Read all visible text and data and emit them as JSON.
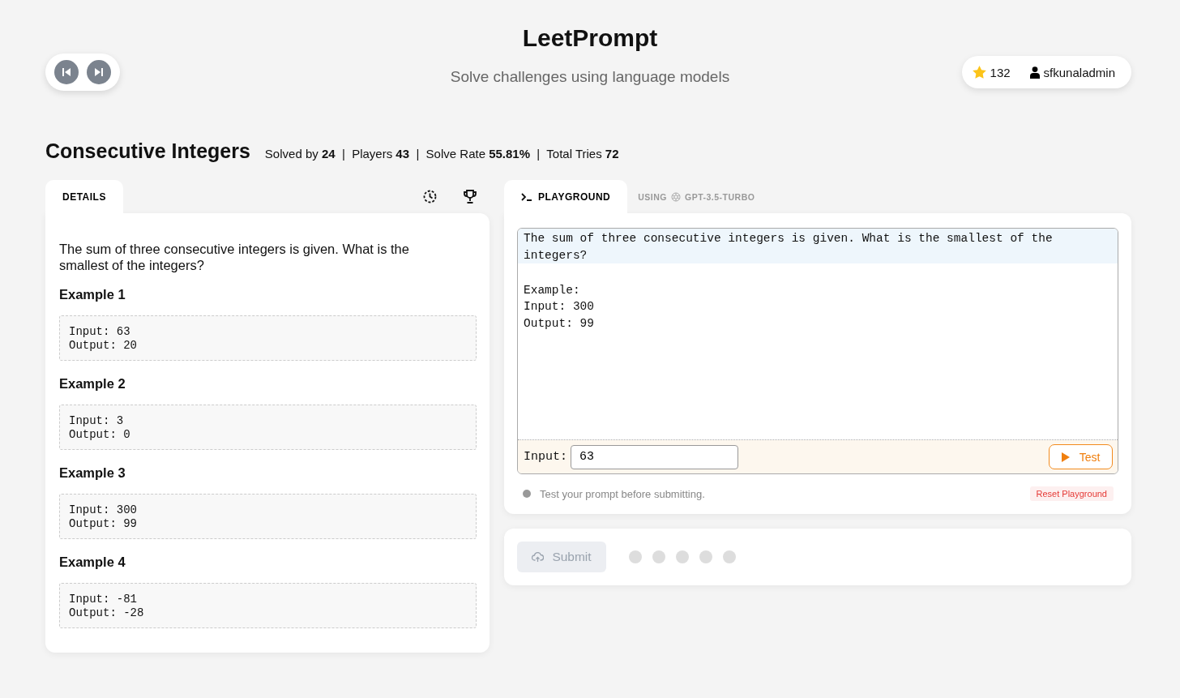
{
  "header": {
    "title": "LeetPrompt",
    "subtitle": "Solve challenges using language models"
  },
  "user": {
    "stars": "132",
    "username": "sfkunaladmin"
  },
  "challenge": {
    "title": "Consecutive Integers",
    "stats": "Solved by **24**  |  Players **43**  |  Solve Rate **55.81%**  |  Total Tries **72**"
  },
  "details": {
    "tab": "DETAILS",
    "description": "The sum of three consecutive integers is given. What is the smallest of the integers?",
    "examples": [
      {
        "title": "Example 1",
        "code": "Input: 63\nOutput: 20"
      },
      {
        "title": "Example 2",
        "code": "Input: 3\nOutput: 0"
      },
      {
        "title": "Example 3",
        "code": "Input: 300\nOutput: 99"
      },
      {
        "title": "Example 4",
        "code": "Input: -81\nOutput: -28"
      }
    ]
  },
  "playground": {
    "tab": "PLAYGROUND",
    "using": "USING",
    "model": "GPT-3.5-TURBO",
    "prompt_lines": [
      {
        "text": "The sum of three consecutive integers is given. What is the smallest of the integers?",
        "highlighted": true
      },
      {
        "text": "\nExample:\nInput: 300\nOutput: 99",
        "highlighted": false
      }
    ],
    "input_label": "Input:",
    "input_value": "63",
    "test_button": "Test",
    "status": "Test your prompt before submitting.",
    "reset_button": "Reset Playground"
  },
  "submit": {
    "label": "Submit",
    "disabled": true,
    "attempts": [
      {
        "filled": false
      },
      {
        "filled": false
      },
      {
        "filled": false
      },
      {
        "filled": false
      },
      {
        "filled": false
      }
    ]
  }
}
